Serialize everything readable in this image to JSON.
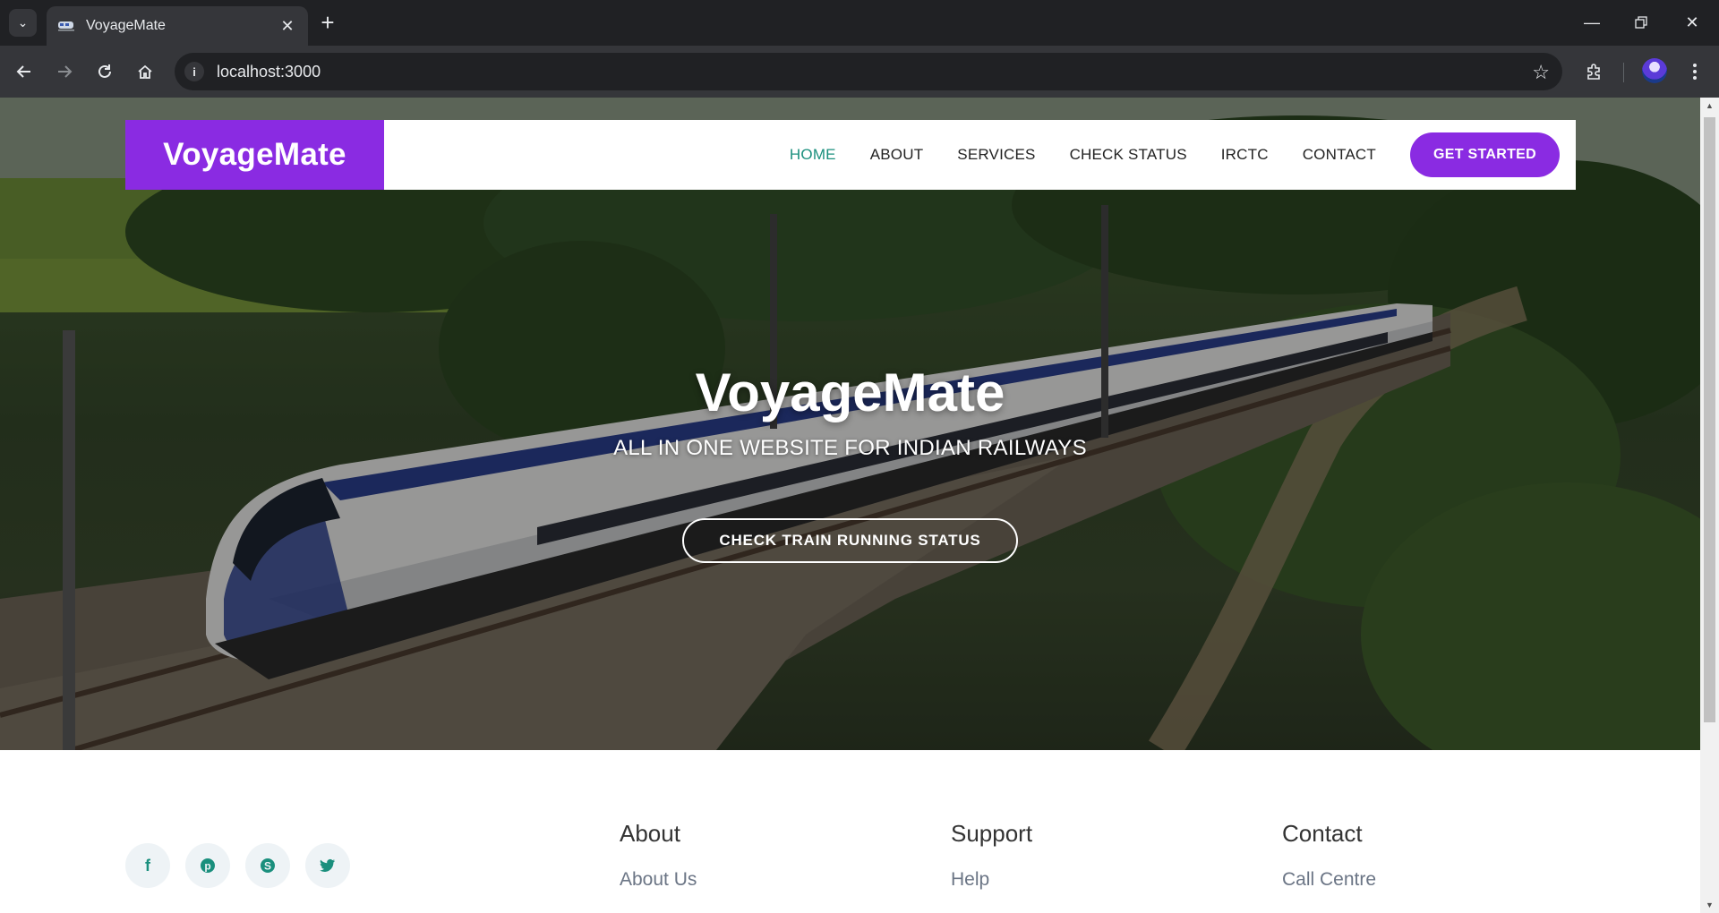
{
  "browser": {
    "tab_title": "VoyageMate",
    "url": "localhost:3000"
  },
  "nav": {
    "brand": "VoyageMate",
    "links": [
      "HOME",
      "ABOUT",
      "SERVICES",
      "CHECK STATUS",
      "IRCTC",
      "CONTACT"
    ],
    "cta": "GET STARTED",
    "active_color": "#1a8f7d",
    "brand_color": "#8a2be2"
  },
  "hero": {
    "title": "VoyageMate",
    "subtitle": "ALL IN ONE WEBSITE FOR INDIAN RAILWAYS",
    "button": "CHECK TRAIN RUNNING STATUS"
  },
  "footer": {
    "social_icons": [
      "facebook-icon",
      "pinterest-icon",
      "skype-icon",
      "twitter-icon"
    ],
    "columns": [
      {
        "heading": "About",
        "link": "About Us"
      },
      {
        "heading": "Support",
        "link": "Help"
      },
      {
        "heading": "Contact",
        "link": "Call Centre"
      }
    ]
  }
}
